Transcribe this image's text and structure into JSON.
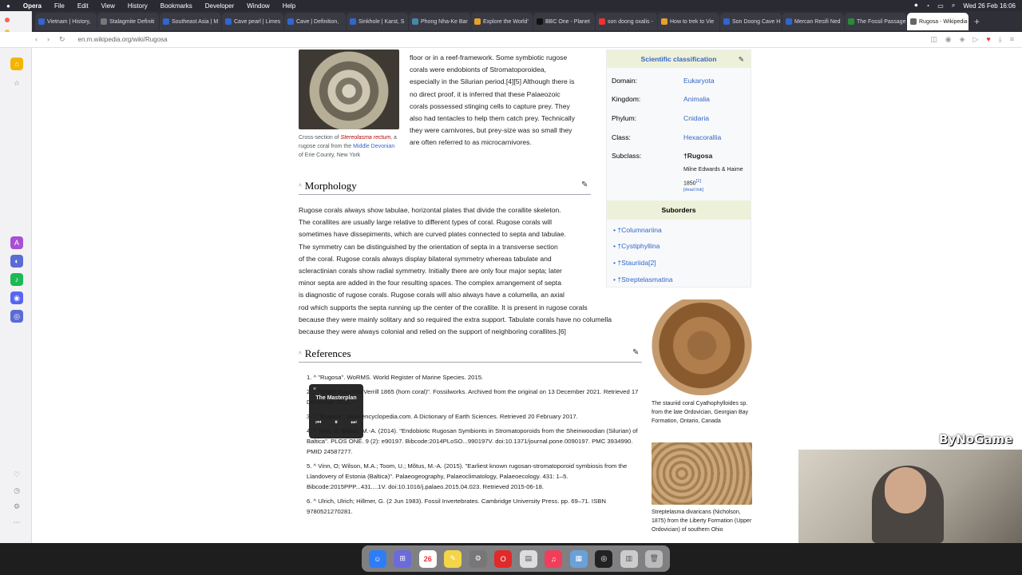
{
  "menubar": {
    "app": "Opera",
    "items": [
      "File",
      "Edit",
      "View",
      "History",
      "Bookmarks",
      "Developer",
      "Window",
      "Help"
    ],
    "clock": "Wed 26 Feb 16:06"
  },
  "tabs": [
    {
      "label": "Vietnam | History,",
      "color": "#3366cc"
    },
    {
      "label": "Stalagmite Definiti",
      "color": "#777"
    },
    {
      "label": "Southeast Asia | M",
      "color": "#3366cc"
    },
    {
      "label": "Cave pearl | Limes",
      "color": "#3366cc"
    },
    {
      "label": "Cave | Definition,",
      "color": "#3366cc"
    },
    {
      "label": "Sinkhole | Karst, S",
      "color": "#3366cc"
    },
    {
      "label": "Phong Nha-Ke Bar",
      "color": "#48a"
    },
    {
      "label": "Explore the World'",
      "color": "#e8a02a"
    },
    {
      "label": "BBC One - Planet",
      "color": "#111"
    },
    {
      "label": "son doong oxalis -",
      "color": "#e33"
    },
    {
      "label": "How to trek to Vie",
      "color": "#e8a02a"
    },
    {
      "label": "Son Doong Cave H",
      "color": "#3366cc"
    },
    {
      "label": "Mercan Resifi Ned",
      "color": "#3366cc"
    },
    {
      "label": "The Fossil Passage",
      "color": "#2a8a3a"
    },
    {
      "label": "Rugosa - Wikipedia",
      "color": "#666"
    }
  ],
  "address": {
    "url": "en.m.wikipedia.org/wiki/Rugosa"
  },
  "figure1_caption_prefix": "Cross-section of ",
  "figure1_caption_species": "Stereolasma rectum",
  "figure1_caption_mid": ", a rugose coral from the ",
  "figure1_caption_link": "Middle Devonian",
  "figure1_caption_suffix": " of Erie County, New York",
  "intro_lines": [
    "floor or in a reef-framework. Some symbiotic rugose",
    "corals were endobionts of Stromatoporoidea,",
    "especially in the Silurian period.[4][5] Although there is",
    "no direct proof, it is inferred that these Palaeozoic",
    "corals possessed stinging cells to capture prey. They",
    "also had tentacles to help them catch prey. Technically",
    "they were carnivores, but prey-size was so small they",
    "are often referred to as microcarnivores."
  ],
  "morphology": {
    "heading": "Morphology",
    "lines": [
      "Rugose corals always show tabulae, horizontal plates that divide the corallite skeleton.",
      "The corallites are usually large relative to different types of coral. Rugose corals will",
      "sometimes have dissepiments, which are curved plates connected to septa and tabulae.",
      "The symmetry can be distinguished by the orientation of septa in a transverse section",
      "of the coral. Rugose corals always display bilateral symmetry whereas tabulate and",
      "scleractinian corals show radial symmetry. Initially there are only four major septa; later",
      "minor septa are added in the four resulting spaces. The complex arrangement of septa",
      "is diagnostic of rugose corals. Rugose corals will also always have a columella, an axial",
      "rod which supports the septa running up the center of the corallite. It is present in rugose corals",
      "because they were mainly solitary and so required the extra support. Tabulate corals have no columella",
      "because they were always colonial and relied on the support of neighboring corallites.[6]"
    ]
  },
  "infobox": {
    "title": "Scientific classification",
    "rows": [
      {
        "k": "Domain:",
        "v": "Eukaryota"
      },
      {
        "k": "Kingdom:",
        "v": "Animalia"
      },
      {
        "k": "Phylum:",
        "v": "Cnidaria"
      },
      {
        "k": "Class:",
        "v": "Hexacorallia"
      },
      {
        "k": "Subclass:",
        "v": "†Rugosa"
      }
    ],
    "authority": "Milne Edwards & Haime 1850",
    "authority_ref": "[1]",
    "dead_link": "[dead link]",
    "suborders_title": "Suborders",
    "suborders": [
      "†Columnariina",
      "†Cystiphyllina",
      "†Stauriida[2]",
      "†Streptelasmatina"
    ]
  },
  "references": {
    "heading": "References",
    "items": [
      "1. ^ \"Rugosa\". WoRMS. World Register of Marine Species. 2015.",
      "2. ^ \"Order Stauriida Verrill 1865 (horn coral)\". Fossilworks. Archived from the original on 13 December 2021. Retrieved 17 December 2021.",
      "3. ^ \"Rugosa\". www.encyclopedia.com. A Dictionary of Earth Sciences. Retrieved 20 February 2017.",
      "4. ^ Vinn, O; Mõtus, M.-A. (2014). \"Endobiotic Rugosan Symbionts in Stromatoporoids from the Sheinwoodian (Silurian) of Baltica\". PLOS ONE. 9 (2): e90197. Bibcode:2014PLoSO...990197V. doi:10.1371/journal.pone.0090197. PMC 3934990. PMID 24587277.",
      "5. ^ Vinn, O; Wilson, M.A.; Toom, U.; Mõtus, M.-A. (2015). \"Earliest known rugosan-stromatoporoid symbiosis from the Llandovery of Estonia (Baltica)\". Palaeogeography, Palaeoclimatology, Palaeoecology. 431: 1–5. Bibcode:2015PPP...431....1V. doi:10.1016/j.palaeo.2015.04.023. Retrieved 2015-06-18.",
      "6. ^ Ulrich, Ulrich; Hillmer, G. (2 Jun 1983). Fossil Invertebrates. Cambridge University Press. pp. 69–71. ISBN 9780521270281."
    ]
  },
  "figure2_caption": "The stauriid coral Cyathophylloides sp. from the late Ordovician, Georgian Bay Formation, Ontario, Canada",
  "figure3_caption": "Streptelasma divaricans (Nicholson, 1875) from the Liberty Formation (Upper Ordovician) of southern Ohio",
  "mini_player": {
    "title": "The Masterplan"
  },
  "overlay_brand": "ByNoGame",
  "dock_date": "26"
}
